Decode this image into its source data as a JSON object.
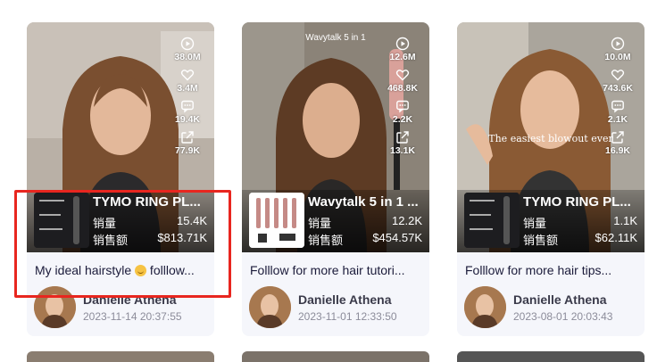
{
  "cards": [
    {
      "stats": {
        "plays": "38.0M",
        "likes": "3.4M",
        "comments": "19.4K",
        "shares": "77.9K"
      },
      "product": {
        "name": "TYMO RING PL...",
        "sales_label": "销量",
        "sales_value": "15.4K",
        "revenue_label": "销售额",
        "revenue_value": "$813.71K"
      },
      "title": "My ideal hairstyle",
      "title_tail": " folllow...",
      "author": {
        "name": "Danielle Athena",
        "date": "2023-11-14 20:37:55"
      }
    },
    {
      "overlay_text": "Wavytalk 5 in 1",
      "stats": {
        "plays": "12.6M",
        "likes": "468.8K",
        "comments": "2.2K",
        "shares": "13.1K"
      },
      "product": {
        "name": "Wavytalk 5 in 1 ...",
        "sales_label": "销量",
        "sales_value": "12.2K",
        "revenue_label": "销售额",
        "revenue_value": "$454.57K"
      },
      "title": "Folllow for more hair tutori...",
      "author": {
        "name": "Danielle Athena",
        "date": "2023-11-01 12:33:50"
      }
    },
    {
      "overlay_text": "The easiest blowout ever",
      "stats": {
        "plays": "10.0M",
        "likes": "743.6K",
        "comments": "2.1K",
        "shares": "16.9K"
      },
      "product": {
        "name": "TYMO RING PL...",
        "sales_label": "销量",
        "sales_value": "1.1K",
        "revenue_label": "销售额",
        "revenue_value": "$62.11K"
      },
      "title": "Folllow for more hair tips...",
      "author": {
        "name": "Danielle Athena",
        "date": "2023-08-01 20:03:43"
      }
    }
  ],
  "colors": {
    "highlight": "#e8261f",
    "card_bg": "#f5f6fb",
    "title_text": "#1b1b3a",
    "date_text": "#8c8c9a"
  },
  "icons": [
    "play-count-icon",
    "heart-icon",
    "comment-icon",
    "share-icon",
    "emoji-icon"
  ]
}
